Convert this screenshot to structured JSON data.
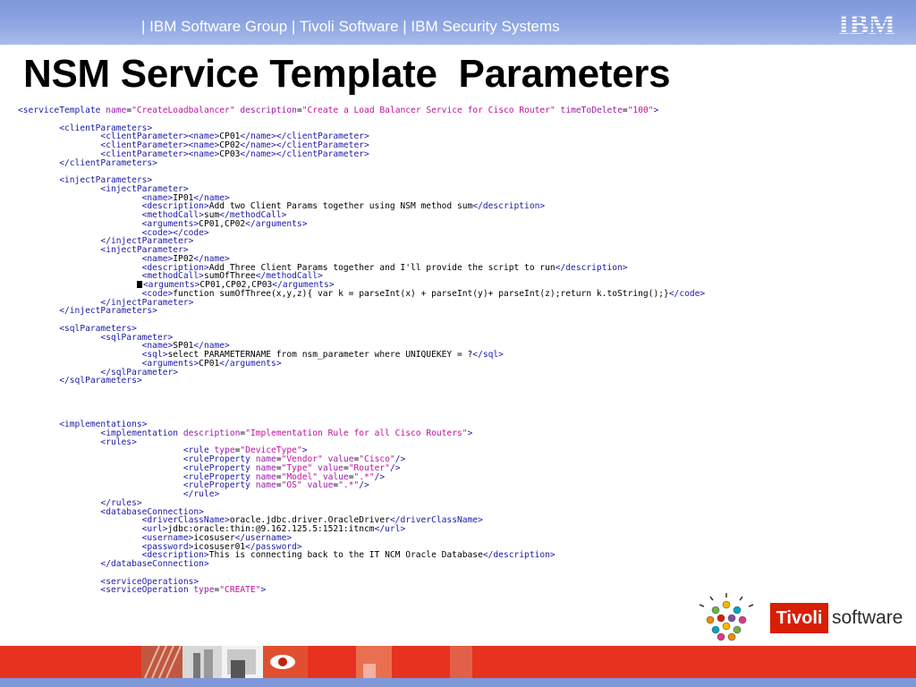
{
  "header": {
    "text": "| IBM Software Group | Tivoli Software | IBM Security Systems",
    "logo": "IBM",
    "band_color": "#8ea6e2"
  },
  "title": "NSM Service Template  Parameters",
  "code_colors": {
    "tag": "#1a1aa6",
    "attribute": "#9a1aa8",
    "value": "#c0129a",
    "text": "#000000"
  },
  "code_lines": [
    [
      [
        "t",
        "<serviceTemplate "
      ],
      [
        "a",
        "name"
      ],
      [
        "x",
        "="
      ],
      [
        "v",
        "\"CreateLoadbalancer\""
      ],
      [
        "x",
        " "
      ],
      [
        "a",
        "description"
      ],
      [
        "x",
        "="
      ],
      [
        "v",
        "\"Create a Load Balancer Service for Cisco Router\""
      ],
      [
        "x",
        " "
      ],
      [
        "a",
        "timeToDelete"
      ],
      [
        "x",
        "="
      ],
      [
        "v",
        "\"100\""
      ],
      [
        "t",
        ">"
      ]
    ],
    [],
    [
      [
        "x",
        "        "
      ],
      [
        "t",
        "<clientParameters>"
      ]
    ],
    [
      [
        "x",
        "                "
      ],
      [
        "t",
        "<clientParameter><name>"
      ],
      [
        "x",
        "CP01"
      ],
      [
        "t",
        "</name></clientParameter>"
      ]
    ],
    [
      [
        "x",
        "                "
      ],
      [
        "t",
        "<clientParameter><name>"
      ],
      [
        "x",
        "CP02"
      ],
      [
        "t",
        "</name></clientParameter>"
      ]
    ],
    [
      [
        "x",
        "                "
      ],
      [
        "t",
        "<clientParameter><name>"
      ],
      [
        "x",
        "CP03"
      ],
      [
        "t",
        "</name></clientParameter>"
      ]
    ],
    [
      [
        "x",
        "        "
      ],
      [
        "t",
        "</clientParameters>"
      ]
    ],
    [],
    [
      [
        "x",
        "        "
      ],
      [
        "t",
        "<injectParameters>"
      ]
    ],
    [
      [
        "x",
        "                "
      ],
      [
        "t",
        "<injectParameter>"
      ]
    ],
    [
      [
        "x",
        "                        "
      ],
      [
        "t",
        "<name>"
      ],
      [
        "x",
        "IP01"
      ],
      [
        "t",
        "</name>"
      ]
    ],
    [
      [
        "x",
        "                        "
      ],
      [
        "t",
        "<description>"
      ],
      [
        "x",
        "Add two Client Params together using NSM method sum"
      ],
      [
        "t",
        "</description>"
      ]
    ],
    [
      [
        "x",
        "                        "
      ],
      [
        "t",
        "<methodCall>"
      ],
      [
        "x",
        "sum"
      ],
      [
        "t",
        "</methodCall>"
      ]
    ],
    [
      [
        "x",
        "                        "
      ],
      [
        "t",
        "<arguments>"
      ],
      [
        "x",
        "CP01,CP02"
      ],
      [
        "t",
        "</arguments>"
      ]
    ],
    [
      [
        "x",
        "                        "
      ],
      [
        "t",
        "<code></code>"
      ]
    ],
    [
      [
        "x",
        "                "
      ],
      [
        "t",
        "</injectParameter>"
      ]
    ],
    [
      [
        "x",
        "                "
      ],
      [
        "t",
        "<injectParameter>"
      ]
    ],
    [
      [
        "x",
        "                        "
      ],
      [
        "t",
        "<name>"
      ],
      [
        "x",
        "IP02"
      ],
      [
        "t",
        "</name>"
      ]
    ],
    [
      [
        "x",
        "                        "
      ],
      [
        "t",
        "<description>"
      ],
      [
        "x",
        "Add Three Client Params together and I'll provide the script to run"
      ],
      [
        "t",
        "</description>"
      ]
    ],
    [
      [
        "x",
        "                        "
      ],
      [
        "t",
        "<methodCall>"
      ],
      [
        "x",
        "sumOfThree"
      ],
      [
        "t",
        "</methodCall>"
      ]
    ],
    [
      [
        "c",
        ""
      ],
      [
        "t",
        "<arguments>"
      ],
      [
        "x",
        "CP01,CP02,CP03"
      ],
      [
        "t",
        "</arguments>"
      ]
    ],
    [
      [
        "x",
        "                        "
      ],
      [
        "t",
        "<code>"
      ],
      [
        "x",
        "function sumOfThree(x,y,z){ var k = parseInt(x) + parseInt(y)+ parseInt(z);return k.toString();}"
      ],
      [
        "t",
        "</code>"
      ]
    ],
    [
      [
        "x",
        "                "
      ],
      [
        "t",
        "</injectParameter>"
      ]
    ],
    [
      [
        "x",
        "        "
      ],
      [
        "t",
        "</injectParameters>"
      ]
    ],
    [],
    [
      [
        "x",
        "        "
      ],
      [
        "t",
        "<sqlParameters>"
      ]
    ],
    [
      [
        "x",
        "                "
      ],
      [
        "t",
        "<sqlParameter>"
      ]
    ],
    [
      [
        "x",
        "                        "
      ],
      [
        "t",
        "<name>"
      ],
      [
        "x",
        "SP01"
      ],
      [
        "t",
        "</name>"
      ]
    ],
    [
      [
        "x",
        "                        "
      ],
      [
        "t",
        "<sql>"
      ],
      [
        "x",
        "select PARAMETERNAME from nsm_parameter where UNIQUEKEY = ?"
      ],
      [
        "t",
        "</sql>"
      ]
    ],
    [
      [
        "x",
        "                        "
      ],
      [
        "t",
        "<arguments>"
      ],
      [
        "x",
        "CP01"
      ],
      [
        "t",
        "</arguments>"
      ]
    ],
    [
      [
        "x",
        "                "
      ],
      [
        "t",
        "</sqlParameter>"
      ]
    ],
    [
      [
        "x",
        "        "
      ],
      [
        "t",
        "</sqlParameters>"
      ]
    ],
    [],
    [],
    [],
    [],
    [
      [
        "x",
        "        "
      ],
      [
        "t",
        "<implementations>"
      ]
    ],
    [
      [
        "x",
        "                "
      ],
      [
        "t",
        "<implementation "
      ],
      [
        "a",
        "description"
      ],
      [
        "x",
        "="
      ],
      [
        "v",
        "\"Implementation Rule for all Cisco Routers\""
      ],
      [
        "t",
        ">"
      ]
    ],
    [
      [
        "x",
        "                "
      ],
      [
        "t",
        "<rules>"
      ]
    ],
    [
      [
        "x",
        "                                "
      ],
      [
        "t",
        "<rule "
      ],
      [
        "a",
        "type"
      ],
      [
        "x",
        "="
      ],
      [
        "v",
        "\"DeviceType\""
      ],
      [
        "t",
        ">"
      ]
    ],
    [
      [
        "x",
        "                                "
      ],
      [
        "t",
        "<ruleProperty "
      ],
      [
        "a",
        "name"
      ],
      [
        "x",
        "="
      ],
      [
        "v",
        "\"Vendor\""
      ],
      [
        "x",
        " "
      ],
      [
        "a",
        "value"
      ],
      [
        "x",
        "="
      ],
      [
        "v",
        "\"Cisco\""
      ],
      [
        "t",
        "/>"
      ]
    ],
    [
      [
        "x",
        "                                "
      ],
      [
        "t",
        "<ruleProperty "
      ],
      [
        "a",
        "name"
      ],
      [
        "x",
        "="
      ],
      [
        "v",
        "\"Type\""
      ],
      [
        "x",
        " "
      ],
      [
        "a",
        "value"
      ],
      [
        "x",
        "="
      ],
      [
        "v",
        "\"Router\""
      ],
      [
        "t",
        "/>"
      ]
    ],
    [
      [
        "x",
        "                                "
      ],
      [
        "t",
        "<ruleProperty "
      ],
      [
        "a",
        "name"
      ],
      [
        "x",
        "="
      ],
      [
        "v",
        "\"Model\""
      ],
      [
        "x",
        " "
      ],
      [
        "a",
        "value"
      ],
      [
        "x",
        "="
      ],
      [
        "v",
        "\".*\""
      ],
      [
        "t",
        "/>"
      ]
    ],
    [
      [
        "x",
        "                                "
      ],
      [
        "t",
        "<ruleProperty "
      ],
      [
        "a",
        "name"
      ],
      [
        "x",
        "="
      ],
      [
        "v",
        "\"OS\""
      ],
      [
        "x",
        " "
      ],
      [
        "a",
        "value"
      ],
      [
        "x",
        "="
      ],
      [
        "v",
        "\".*\""
      ],
      [
        "t",
        "/>"
      ]
    ],
    [
      [
        "x",
        "                                "
      ],
      [
        "t",
        "</rule>"
      ]
    ],
    [
      [
        "x",
        "                "
      ],
      [
        "t",
        "</rules>"
      ]
    ],
    [
      [
        "x",
        "                "
      ],
      [
        "t",
        "<databaseConnection>"
      ]
    ],
    [
      [
        "x",
        "                        "
      ],
      [
        "t",
        "<driverClassName>"
      ],
      [
        "x",
        "oracle.jdbc.driver.OracleDriver"
      ],
      [
        "t",
        "</driverClassName>"
      ]
    ],
    [
      [
        "x",
        "                        "
      ],
      [
        "t",
        "<url>"
      ],
      [
        "x",
        "jdbc:oracle:thin:@9.162.125.5:1521:itncm"
      ],
      [
        "t",
        "</url>"
      ]
    ],
    [
      [
        "x",
        "                        "
      ],
      [
        "t",
        "<username>"
      ],
      [
        "x",
        "icosuser"
      ],
      [
        "t",
        "</username>"
      ]
    ],
    [
      [
        "x",
        "                        "
      ],
      [
        "t",
        "<password>"
      ],
      [
        "x",
        "icosuser01"
      ],
      [
        "t",
        "</password>"
      ]
    ],
    [
      [
        "x",
        "                        "
      ],
      [
        "t",
        "<description>"
      ],
      [
        "x",
        "This is connecting back to the IT NCM Oracle Database"
      ],
      [
        "t",
        "</description>"
      ]
    ],
    [
      [
        "x",
        "                "
      ],
      [
        "t",
        "</databaseConnection>"
      ]
    ],
    [],
    [
      [
        "x",
        "                "
      ],
      [
        "t",
        "<serviceOperations>"
      ]
    ],
    [
      [
        "x",
        "                "
      ],
      [
        "t",
        "<serviceOperation "
      ],
      [
        "a",
        "type"
      ],
      [
        "x",
        "="
      ],
      [
        "v",
        "\"CREATE\""
      ],
      [
        "t",
        ">"
      ]
    ]
  ],
  "footer_logo": {
    "brand": "Tivoli",
    "suffix": "software",
    "brand_color": "#d81e05"
  },
  "footer_colors": {
    "strip": "#e6321e",
    "bottom_band": "#7f98d8"
  }
}
